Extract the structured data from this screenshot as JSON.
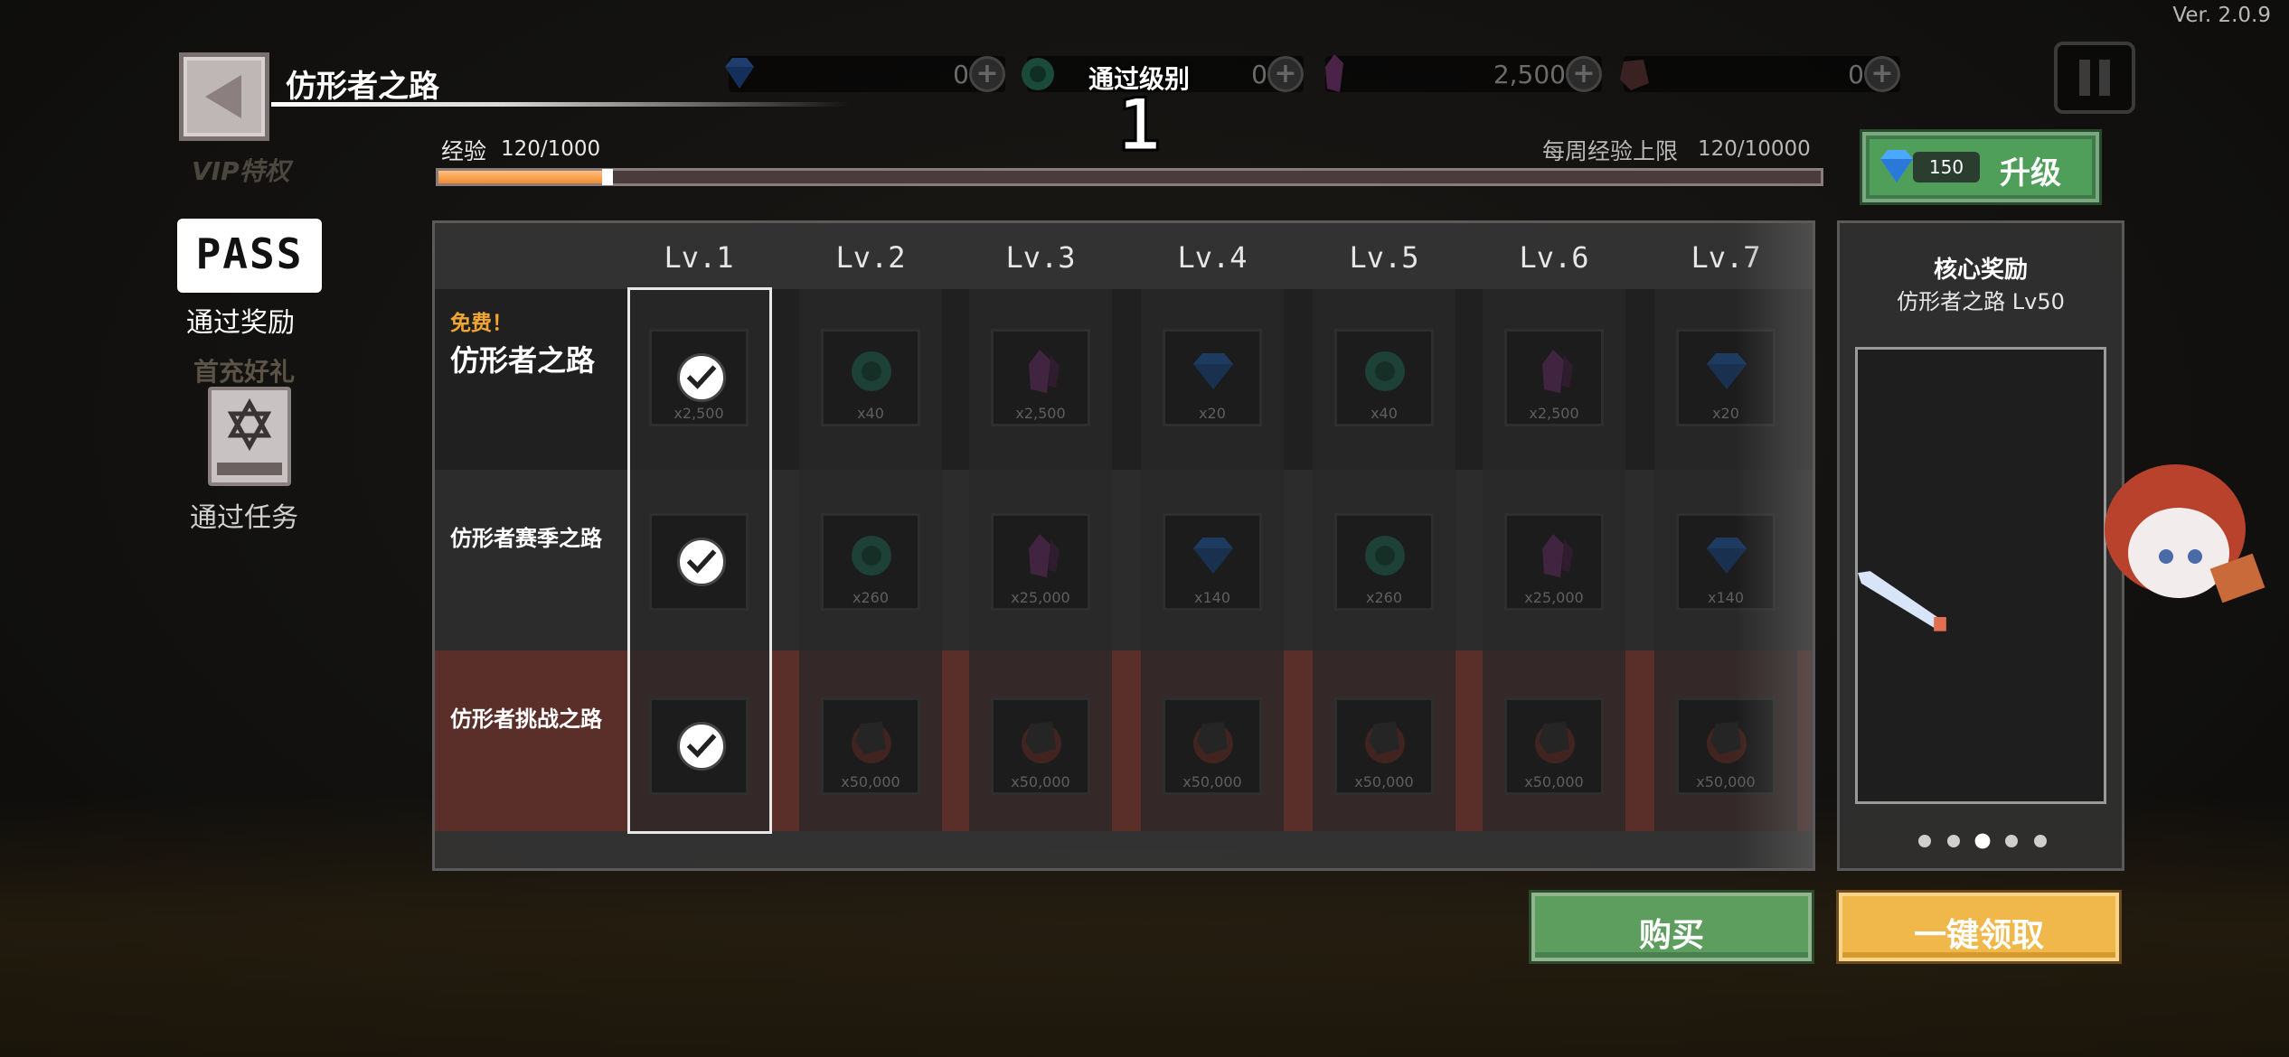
{
  "version": "Ver. 2.0.9",
  "header": {
    "title": "仿形者之路",
    "back_icon": "back-arrow-icon",
    "faded_vip": "VIP特权"
  },
  "currencies": [
    {
      "name": "gem",
      "icon": "blue-gem-icon",
      "value": "0"
    },
    {
      "name": "token",
      "icon": "green-token-icon",
      "value": "0"
    },
    {
      "name": "crystal",
      "icon": "purple-crystal-icon",
      "value": "2,500"
    },
    {
      "name": "ore",
      "icon": "dark-ore-icon",
      "value": "0"
    }
  ],
  "level": {
    "label": "通过级别",
    "value": "1"
  },
  "experience": {
    "label": "经验",
    "value": "120/1000",
    "progress": 0.12,
    "weekly_label": "每周经验上限",
    "weekly_value": "120/10000"
  },
  "upgrade": {
    "cost": "150",
    "label": "升级"
  },
  "nav": {
    "pass_badge": "PASS",
    "pass_label": "通过奖励",
    "first_topup": "首充好礼",
    "quest_label": "通过任务"
  },
  "grid": {
    "levels": [
      "Lv.1",
      "Lv.2",
      "Lv.3",
      "Lv.4",
      "Lv.5",
      "Lv.6",
      "Lv.7"
    ],
    "free_tag": "免费！",
    "rows": [
      {
        "label": "仿形者之路",
        "rewards": [
          {
            "icon": "claimed-check-icon",
            "qty": "x2,500"
          },
          {
            "icon": "green-token-icon",
            "qty": "x40"
          },
          {
            "icon": "purple-crystal-icon",
            "qty": "x2,500"
          },
          {
            "icon": "blue-gem-icon",
            "qty": "x20"
          },
          {
            "icon": "green-token-icon",
            "qty": "x40"
          },
          {
            "icon": "purple-crystal-icon",
            "qty": "x2,500"
          },
          {
            "icon": "blue-gem-icon",
            "qty": "x20"
          }
        ]
      },
      {
        "label": "仿形者赛季之路",
        "rewards": [
          {
            "icon": "claimed-check-icon",
            "qty": ""
          },
          {
            "icon": "green-token-icon",
            "qty": "x260"
          },
          {
            "icon": "purple-crystal-icon",
            "qty": "x25,000"
          },
          {
            "icon": "blue-gem-icon",
            "qty": "x140"
          },
          {
            "icon": "green-token-icon",
            "qty": "x260"
          },
          {
            "icon": "purple-crystal-icon",
            "qty": "x25,000"
          },
          {
            "icon": "blue-gem-icon",
            "qty": "x140"
          }
        ]
      },
      {
        "label": "仿形者挑战之路",
        "rewards": [
          {
            "icon": "claimed-check-icon",
            "qty": ""
          },
          {
            "icon": "dark-ore-icon",
            "qty": "x50,000"
          },
          {
            "icon": "dark-ore-icon",
            "qty": "x50,000"
          },
          {
            "icon": "dark-ore-icon",
            "qty": "x50,000"
          },
          {
            "icon": "dark-ore-icon",
            "qty": "x50,000"
          },
          {
            "icon": "dark-ore-icon",
            "qty": "x50,000"
          },
          {
            "icon": "dark-ore-icon",
            "qty": "x50,000"
          }
        ]
      }
    ]
  },
  "core_reward": {
    "title": "核心奖励",
    "subtitle": "仿形者之路 Lv50",
    "page_index": 3,
    "page_count": 5
  },
  "buttons": {
    "buy": "购买",
    "claim_all": "一键领取"
  },
  "colors": {
    "accent_orange": "#f08a30",
    "buy_green": "#5d9e5f",
    "claim_gold": "#f0b84a",
    "challenge_row": "#5a2f2a",
    "free_tag": "#f2a632"
  }
}
